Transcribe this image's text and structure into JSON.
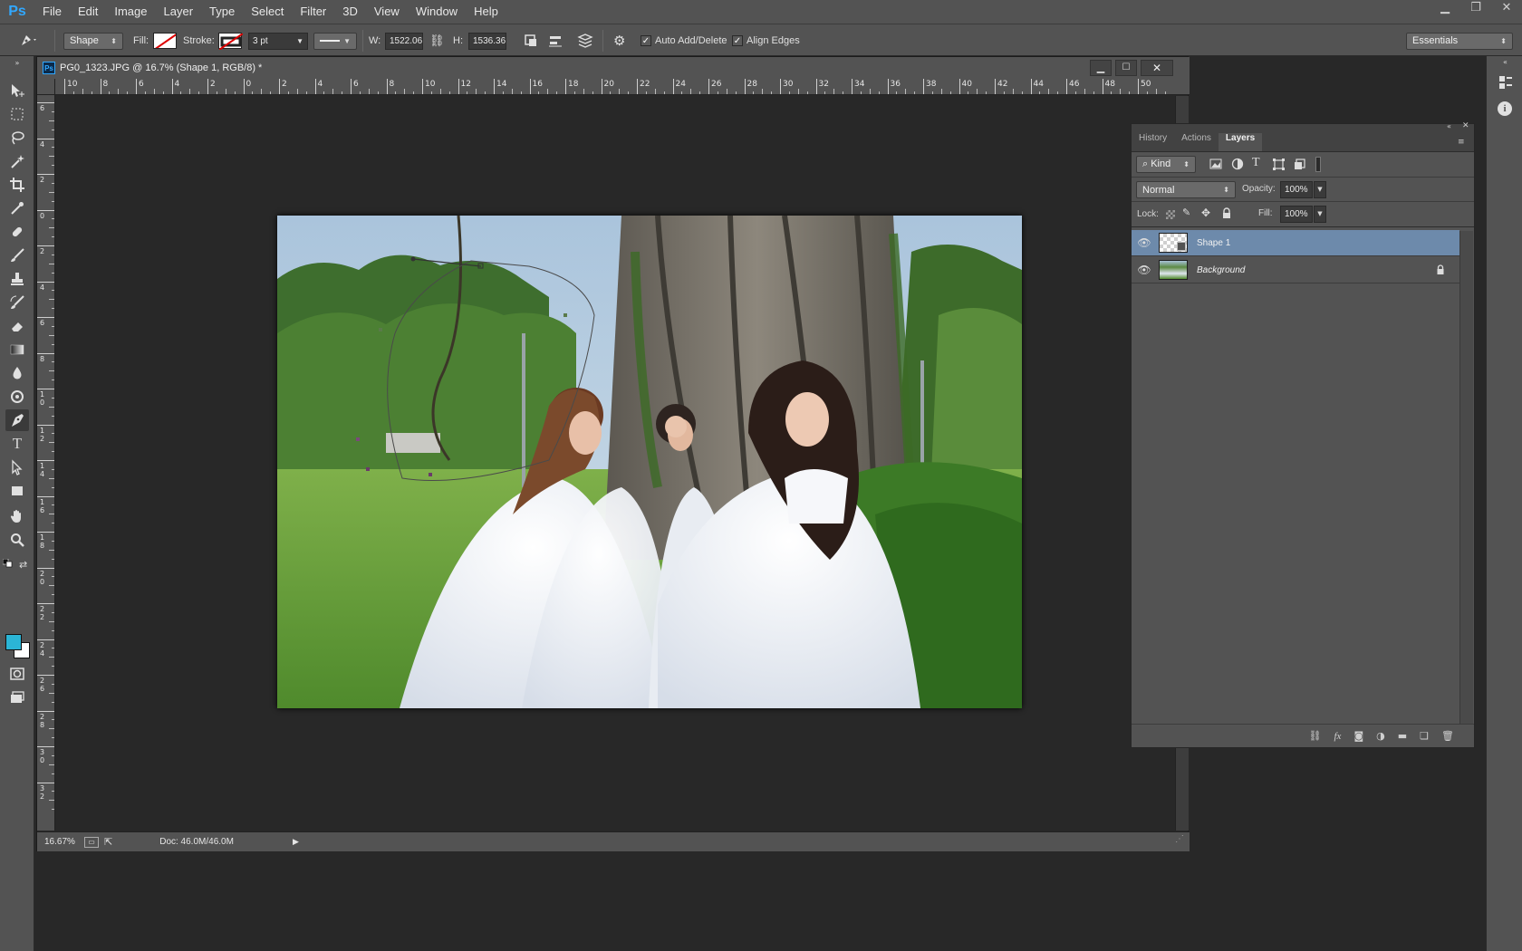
{
  "app": {
    "logo": "Ps"
  },
  "menubar": {
    "items": [
      "File",
      "Edit",
      "Image",
      "Layer",
      "Type",
      "Select",
      "Filter",
      "3D",
      "View",
      "Window",
      "Help"
    ]
  },
  "window_controls": {
    "minimize": "▁",
    "restore": "❐",
    "close": "✕"
  },
  "options_bar": {
    "tool_icon": "pen-icon",
    "mode": "Shape",
    "fill_label": "Fill:",
    "stroke_label": "Stroke:",
    "stroke_width": "3 pt",
    "w_label": "W:",
    "w_value": "1522.06",
    "h_label": "H:",
    "h_value": "1536.36",
    "auto_add_delete": "Auto Add/Delete",
    "align_edges": "Align Edges",
    "workspace": "Essentials"
  },
  "document": {
    "title": "PG0_1323.JPG @ 16.7% (Shape 1, RGB/8) *",
    "zoom": "16.67%",
    "doc_size": "Doc: 46.0M/46.0M",
    "hruler_labels": [
      "10",
      "8",
      "6",
      "4",
      "2",
      "0",
      "2",
      "4",
      "6",
      "8",
      "10",
      "12",
      "14",
      "16",
      "18",
      "20",
      "22",
      "24",
      "26",
      "28",
      "30",
      "32",
      "34",
      "36",
      "38",
      "40",
      "42",
      "44",
      "46",
      "48",
      "50"
    ],
    "vruler_labels": [
      "6",
      "4",
      "2",
      "0",
      "2",
      "4",
      "6",
      "8",
      "10",
      "12",
      "14",
      "16",
      "18",
      "20",
      "22",
      "24",
      "26",
      "28",
      "30",
      "32"
    ]
  },
  "layers_panel": {
    "tabs": [
      "History",
      "Actions",
      "Layers"
    ],
    "active_tab": "Layers",
    "filter_kind": "Kind",
    "blend_mode": "Normal",
    "opacity_label": "Opacity:",
    "opacity_value": "100%",
    "lock_label": "Lock:",
    "fill_label": "Fill:",
    "fill_value": "100%",
    "layers": [
      {
        "name": "Shape 1",
        "selected": true,
        "visible": true
      },
      {
        "name": "Background",
        "selected": false,
        "visible": true,
        "locked": true
      }
    ]
  },
  "colors": {
    "foreground": "#2bb5d6",
    "background": "#ffffff",
    "selection": "#6d8aab",
    "panel": "#535353"
  }
}
